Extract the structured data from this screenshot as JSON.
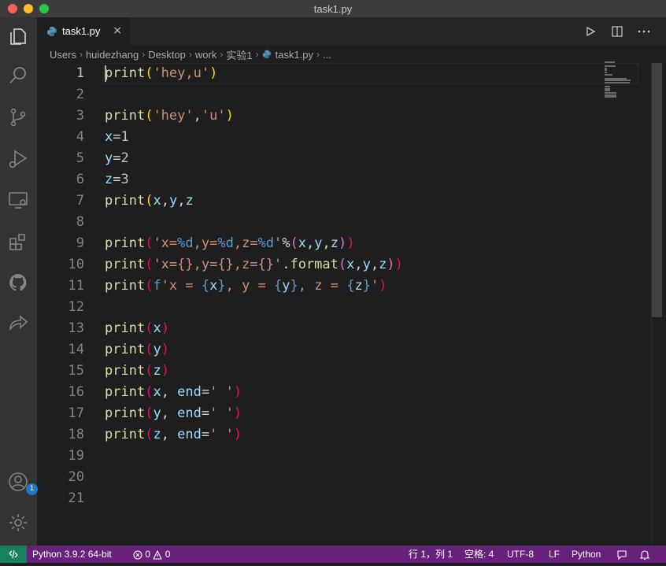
{
  "window": {
    "title": "task1.py"
  },
  "tab": {
    "label": "task1.py",
    "close_glyph": "×"
  },
  "breadcrumb": {
    "items": [
      "Users",
      "huidezhang",
      "Desktop",
      "work",
      "实验1",
      "task1.py",
      "..."
    ],
    "separator": "›"
  },
  "editor": {
    "language": "python",
    "lines": [
      {
        "n": "1",
        "current": true,
        "tokens": [
          [
            "fn",
            "print"
          ],
          [
            "p1",
            "("
          ],
          [
            "str",
            "'hey,u'"
          ],
          [
            "p1",
            ")"
          ]
        ]
      },
      {
        "n": "2",
        "tokens": []
      },
      {
        "n": "3",
        "tokens": [
          [
            "fn",
            "print"
          ],
          [
            "p1",
            "("
          ],
          [
            "str",
            "'hey'"
          ],
          [
            "def",
            ","
          ],
          [
            "str",
            "'u'"
          ],
          [
            "p1",
            ")"
          ]
        ]
      },
      {
        "n": "4",
        "tokens": [
          [
            "var",
            "x"
          ],
          [
            "def",
            "="
          ],
          [
            "num",
            "1"
          ]
        ]
      },
      {
        "n": "5",
        "tokens": [
          [
            "var",
            "y"
          ],
          [
            "def",
            "="
          ],
          [
            "num",
            "2"
          ]
        ]
      },
      {
        "n": "6",
        "tokens": [
          [
            "var",
            "z"
          ],
          [
            "def",
            "="
          ],
          [
            "num",
            "3"
          ]
        ]
      },
      {
        "n": "7",
        "tokens": [
          [
            "fn",
            "print"
          ],
          [
            "p1",
            "("
          ],
          [
            "var",
            "x"
          ],
          [
            "def",
            ","
          ],
          [
            "var",
            "y"
          ],
          [
            "def",
            ","
          ],
          [
            "var",
            "z"
          ]
        ]
      },
      {
        "n": "8",
        "tokens": []
      },
      {
        "n": "9",
        "tokens": [
          [
            "fn",
            "print"
          ],
          [
            "p3",
            "("
          ],
          [
            "str",
            "'x="
          ],
          [
            "esc",
            "%d"
          ],
          [
            "str",
            ",y="
          ],
          [
            "esc",
            "%d"
          ],
          [
            "str",
            ",z="
          ],
          [
            "esc",
            "%d"
          ],
          [
            "str",
            "'"
          ],
          [
            "def",
            "%"
          ],
          [
            "p2",
            "("
          ],
          [
            "var",
            "x"
          ],
          [
            "def",
            ","
          ],
          [
            "var",
            "y"
          ],
          [
            "def",
            ","
          ],
          [
            "var",
            "z"
          ],
          [
            "p2",
            ")"
          ],
          [
            "p3",
            ")"
          ]
        ]
      },
      {
        "n": "10",
        "tokens": [
          [
            "fn",
            "print"
          ],
          [
            "p3",
            "("
          ],
          [
            "str",
            "'x={},y={},z={}'"
          ],
          [
            "def",
            "."
          ],
          [
            "fn",
            "format"
          ],
          [
            "p2",
            "("
          ],
          [
            "var",
            "x"
          ],
          [
            "def",
            ","
          ],
          [
            "var",
            "y"
          ],
          [
            "def",
            ","
          ],
          [
            "var",
            "z"
          ],
          [
            "p2",
            ")"
          ],
          [
            "p3",
            ")"
          ]
        ]
      },
      {
        "n": "11",
        "tokens": [
          [
            "fn",
            "print"
          ],
          [
            "p3",
            "("
          ],
          [
            "kw",
            "f"
          ],
          [
            "str",
            "'x = "
          ],
          [
            "esc",
            "{"
          ],
          [
            "var",
            "x"
          ],
          [
            "esc",
            "}"
          ],
          [
            "str",
            ", y = "
          ],
          [
            "esc",
            "{"
          ],
          [
            "var",
            "y"
          ],
          [
            "esc",
            "}"
          ],
          [
            "str",
            ", z = "
          ],
          [
            "esc",
            "{"
          ],
          [
            "var",
            "z"
          ],
          [
            "esc",
            "}"
          ],
          [
            "str",
            "'"
          ],
          [
            "p3",
            ")"
          ]
        ]
      },
      {
        "n": "12",
        "tokens": []
      },
      {
        "n": "13",
        "tokens": [
          [
            "fn",
            "print"
          ],
          [
            "p3",
            "("
          ],
          [
            "var",
            "x"
          ],
          [
            "p3",
            ")"
          ]
        ]
      },
      {
        "n": "14",
        "tokens": [
          [
            "fn",
            "print"
          ],
          [
            "p3",
            "("
          ],
          [
            "var",
            "y"
          ],
          [
            "p3",
            ")"
          ]
        ]
      },
      {
        "n": "15",
        "tokens": [
          [
            "fn",
            "print"
          ],
          [
            "p3",
            "("
          ],
          [
            "var",
            "z"
          ],
          [
            "p3",
            ")"
          ]
        ]
      },
      {
        "n": "16",
        "tokens": [
          [
            "fn",
            "print"
          ],
          [
            "p3",
            "("
          ],
          [
            "var",
            "x"
          ],
          [
            "def",
            ", "
          ],
          [
            "var",
            "end"
          ],
          [
            "def",
            "="
          ],
          [
            "str",
            "' '"
          ],
          [
            "p3",
            ")"
          ]
        ]
      },
      {
        "n": "17",
        "tokens": [
          [
            "fn",
            "print"
          ],
          [
            "p3",
            "("
          ],
          [
            "var",
            "y"
          ],
          [
            "def",
            ", "
          ],
          [
            "var",
            "end"
          ],
          [
            "def",
            "="
          ],
          [
            "str",
            "' '"
          ],
          [
            "p3",
            ")"
          ]
        ]
      },
      {
        "n": "18",
        "tokens": [
          [
            "fn",
            "print"
          ],
          [
            "p3",
            "("
          ],
          [
            "var",
            "z"
          ],
          [
            "def",
            ", "
          ],
          [
            "var",
            "end"
          ],
          [
            "def",
            "="
          ],
          [
            "str",
            "' '"
          ],
          [
            "p3",
            ")"
          ]
        ]
      },
      {
        "n": "19",
        "tokens": []
      },
      {
        "n": "20",
        "tokens": []
      },
      {
        "n": "21",
        "tokens": []
      }
    ]
  },
  "activity_bar": {
    "items": [
      {
        "name": "explorer-icon"
      },
      {
        "name": "search-icon"
      },
      {
        "name": "source-control-icon"
      },
      {
        "name": "run-debug-icon"
      },
      {
        "name": "remote-explorer-icon"
      },
      {
        "name": "extensions-icon"
      },
      {
        "name": "github-icon"
      },
      {
        "name": "live-share-icon"
      }
    ],
    "accounts_badge": "1"
  },
  "status_bar": {
    "interpreter": "Python 3.9.2 64-bit",
    "errors": "0",
    "warnings": "0",
    "cursor_position": "行 1，列 1",
    "indentation": "空格: 4",
    "encoding": "UTF-8",
    "eol": "LF",
    "language_mode": "Python",
    "colors": {
      "background": "#68217a",
      "remote": "#16825d"
    }
  },
  "colors": {
    "editor_bg": "#1e1e1e",
    "function": "#dcdcaa",
    "string": "#ce9178",
    "variable": "#9cdcfe",
    "number": "#b5cea8",
    "keyword": "#569cd6"
  }
}
